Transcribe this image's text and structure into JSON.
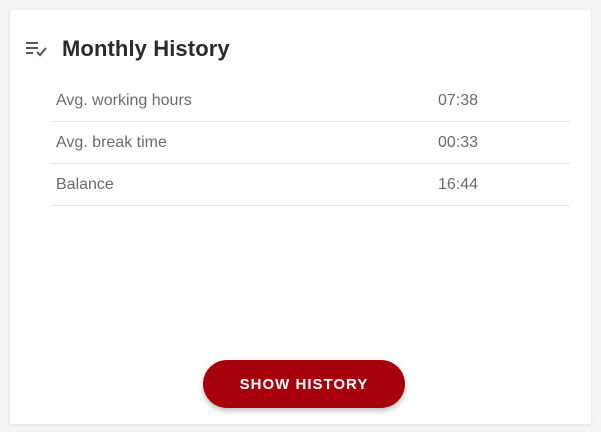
{
  "header": {
    "title": "Monthly History",
    "icon": "playlist-check-icon"
  },
  "stats": [
    {
      "label": "Avg. working hours",
      "value": "07:38"
    },
    {
      "label": "Avg. break time",
      "value": "00:33"
    },
    {
      "label": "Balance",
      "value": "16:44"
    }
  ],
  "actions": {
    "show_history_label": "SHOW HISTORY"
  },
  "colors": {
    "accent": "#a5000b",
    "title_text": "#2b2b2b",
    "row_text": "#6b6b6b",
    "divider": "#e6e6e6"
  }
}
